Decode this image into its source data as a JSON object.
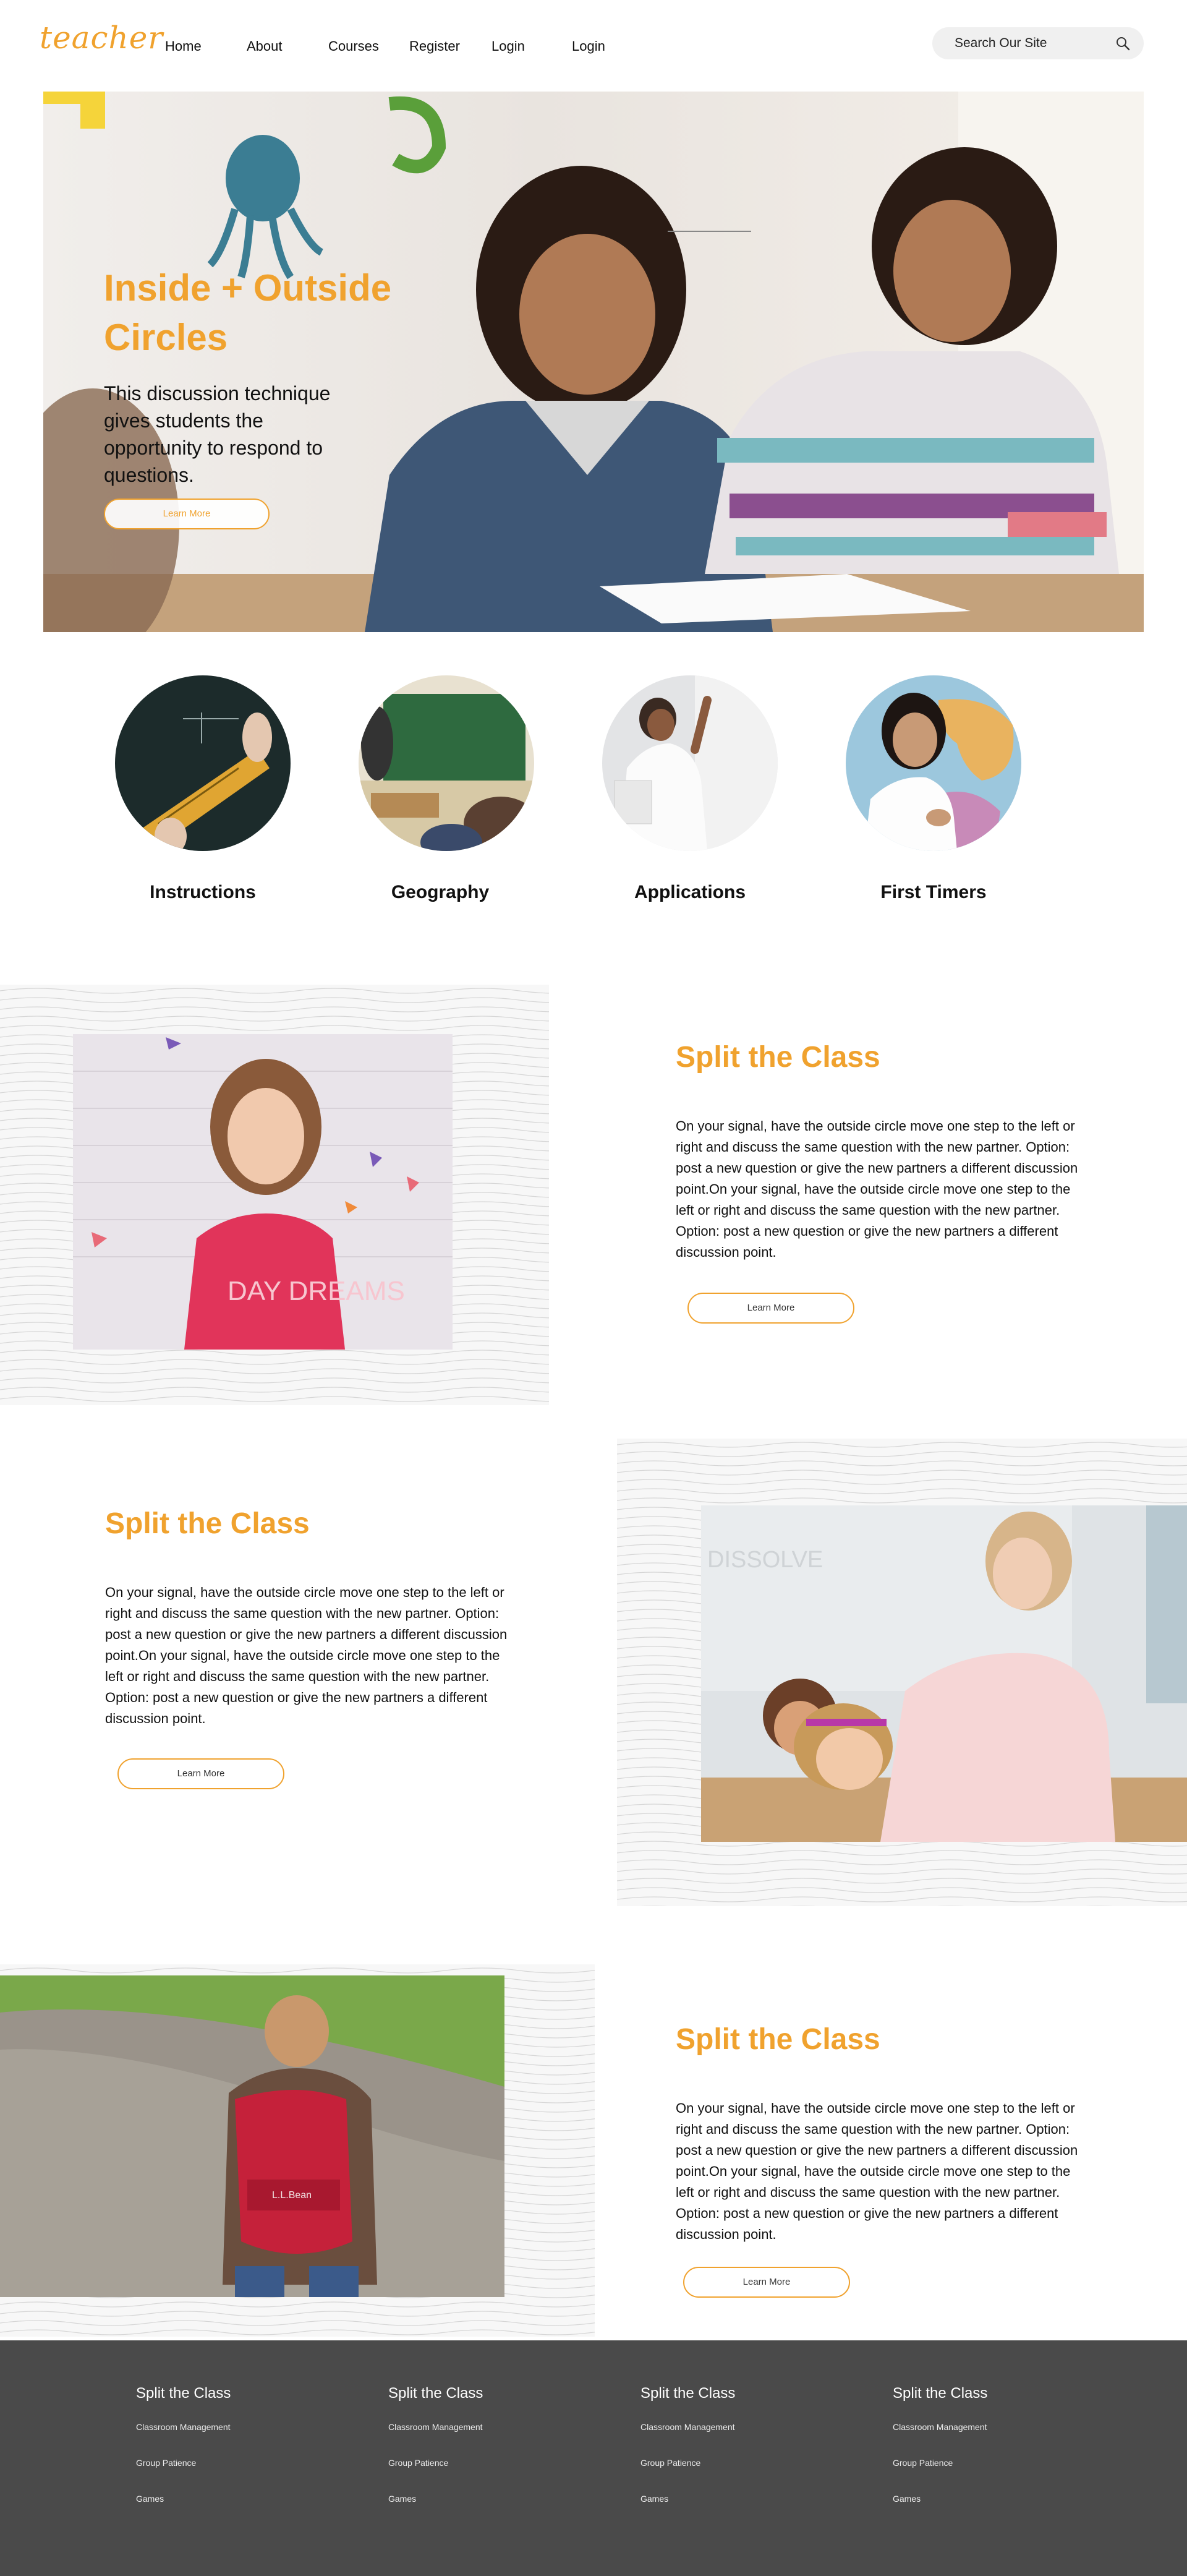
{
  "header": {
    "logo": "teacher",
    "nav": [
      "Home",
      "About",
      "Courses",
      "Register",
      "Login",
      "Login"
    ],
    "search_placeholder": "Search Our Site"
  },
  "hero": {
    "title": "Inside + Outside Circles",
    "subtitle": "This discussion technique gives students the opportunity to respond to questions.",
    "button": "Learn More"
  },
  "categories": [
    {
      "label": "Instructions"
    },
    {
      "label": "Geography"
    },
    {
      "label": "Applications"
    },
    {
      "label": "First Timers"
    }
  ],
  "features": [
    {
      "title": "Split the Class",
      "body": "On your signal, have the outside circle move one step to the left or right and discuss the same question with the new partner. Option: post a new question or give the new partners a different discussion point.On your signal, have the outside circle move one step to the left or right and discuss the same question with the new partner. Option: post a new question or give the new partners a different discussion point.",
      "button": "Learn More",
      "image_text": "DAY DREAMS"
    },
    {
      "title": "Split the Class",
      "body": "On your signal, have the outside circle move one step to the left or right and discuss the same question with the new partner. Option: post a new question or give the new partners a different discussion point.On your signal, have the outside circle move one step to the left or right and discuss the same question with the new partner. Option: post a new question or give the new partners a different discussion point.",
      "button": "Learn More",
      "image_text": "DISSOLVE"
    },
    {
      "title": "Split the Class",
      "body": "On your signal, have the outside circle move one step to the left or right and discuss the same question with the new partner. Option: post a new question or give the new partners a different discussion point.On your signal, have the outside circle move one step to the left or right and discuss the same question with the new partner. Option: post a new question or give the new partners a different discussion point.",
      "button": "Learn More",
      "image_text": "L.L.Bean"
    }
  ],
  "footer": {
    "columns": [
      {
        "title": "Split the Class",
        "links": [
          "Classroom Management",
          "Group Patience",
          "Games"
        ]
      },
      {
        "title": "Split the Class",
        "links": [
          "Classroom Management",
          "Group Patience",
          "Games"
        ]
      },
      {
        "title": "Split the Class",
        "links": [
          "Classroom Management",
          "Group Patience",
          "Games"
        ]
      },
      {
        "title": "Split the Class",
        "links": [
          "Classroom Management",
          "Group Patience",
          "Games"
        ]
      }
    ]
  },
  "colors": {
    "accent": "#f0a22e",
    "footer_bg": "#4a4a4a"
  }
}
